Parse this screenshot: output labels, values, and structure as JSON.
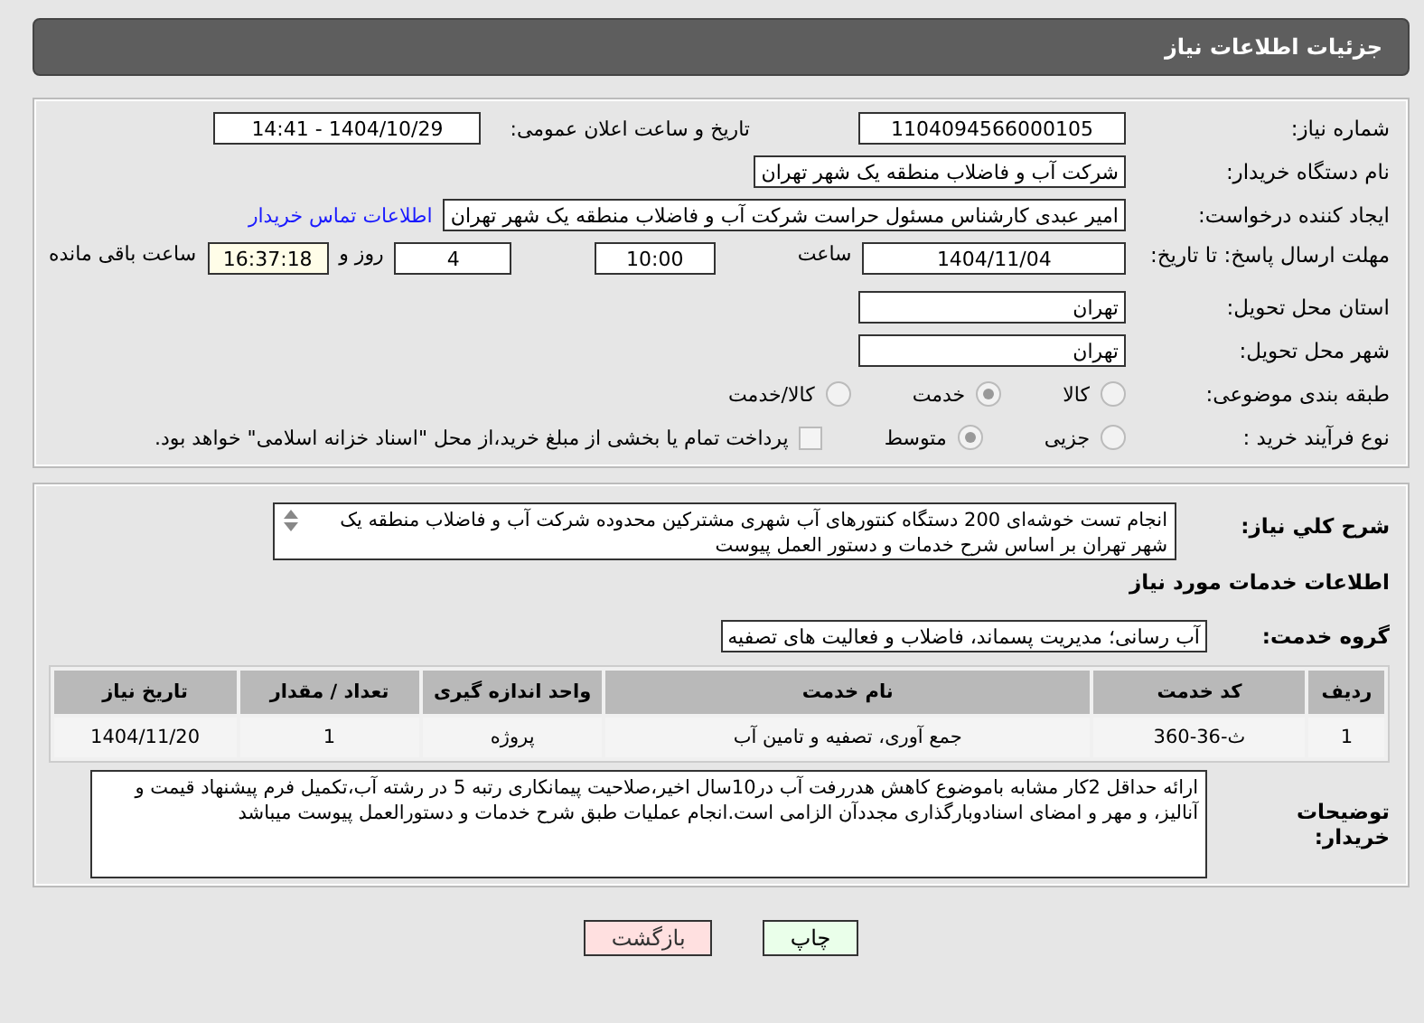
{
  "header": {
    "title": "جزئیات اطلاعات نیاز"
  },
  "need_number": {
    "label": "شماره نیاز:",
    "value": "1104094566000105"
  },
  "announce": {
    "label": "تاریخ و ساعت اعلان عمومی:",
    "value": "1404/10/29 - 14:41"
  },
  "buyer": {
    "label": "نام دستگاه خریدار:",
    "value": "شرکت آب و فاضلاب منطقه یک شهر تهران"
  },
  "creator": {
    "label": "ایجاد کننده درخواست:",
    "value": "امیر عبدی کارشناس مسئول حراست شرکت آب و فاضلاب منطقه یک شهر تهران",
    "link": "اطلاعات تماس خریدار"
  },
  "deadline": {
    "label": "مهلت ارسال پاسخ: تا تاریخ:",
    "date": "1404/11/04",
    "time_label": "ساعت",
    "time": "10:00",
    "days": "4",
    "days_label": "روز و",
    "remaining": "16:37:18",
    "remaining_label": "ساعت باقی مانده"
  },
  "province": {
    "label": "استان محل تحویل:",
    "value": "تهران"
  },
  "city": {
    "label": "شهر محل تحویل:",
    "value": "تهران"
  },
  "category": {
    "label": "طبقه بندی موضوعی:",
    "options": [
      {
        "label": "کالا",
        "selected": false
      },
      {
        "label": "خدمت",
        "selected": true
      },
      {
        "label": "کالا/خدمت",
        "selected": false
      }
    ]
  },
  "process": {
    "label": "نوع فرآیند خرید :",
    "options": [
      {
        "label": "جزیی",
        "selected": false
      },
      {
        "label": "متوسط",
        "selected": true
      }
    ],
    "payment": {
      "checked": false,
      "label": "پرداخت تمام یا بخشی از مبلغ خرید،از محل \"اسناد خزانه اسلامی\" خواهد بود."
    }
  },
  "description": {
    "label": "شرح کلي نياز:",
    "value": "انجام تست خوشه‌ای 200 دستگاه کنتورهای آب شهری مشترکین محدوده شرکت آب و فاضلاب منطقه یک شهر تهران بر اساس شرح خدمات و دستور العمل پیوست"
  },
  "services_heading": "اطلاعات خدمات مورد نیاز",
  "service_group": {
    "label": "گروه خدمت:",
    "value": "آب رسانی؛ مدیریت پسماند، فاضلاب و فعالیت های تصفیه"
  },
  "table": {
    "columns": [
      "ردیف",
      "کد خدمت",
      "نام خدمت",
      "واحد اندازه گیری",
      "تعداد / مقدار",
      "تاریخ نیاز"
    ],
    "rows": [
      [
        "1",
        "ث-36-360",
        "جمع آوری، تصفیه و تامین آب",
        "پروژه",
        "1",
        "1404/11/20"
      ]
    ]
  },
  "buyer_notes": {
    "label": "توضیحات خریدار:",
    "value": "ارائه حداقل 2کار مشابه باموضوع کاهش هدررفت آب در10سال اخیر،صلاحیت پیمانکاری رتبه 5 در رشته آب،تکمیل فرم پیشنهاد قیمت و آنالیز، و مهر و امضای اسنادوبارگذاری مجددآن الزامی است.انجام عملیات طبق شرح خدمات و دستورالعمل پیوست میباشد"
  },
  "buttons": [
    {
      "kind": "print",
      "label": "چاپ"
    },
    {
      "kind": "back",
      "label": "بازگشت"
    }
  ]
}
